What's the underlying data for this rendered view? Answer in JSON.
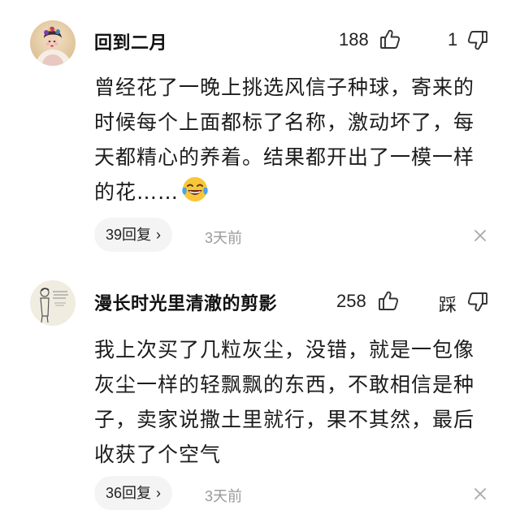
{
  "comments": [
    {
      "username": "回到二月",
      "likes": "188",
      "dislike": "1",
      "body": "曾经花了一晚上挑选风信子种球，寄来的时候每个上面都标了名称，激动坏了，每天都精心的养着。结果都开出了一模一样的花……",
      "emoji": "laughing-tears-emoji",
      "replies": "39回复",
      "reply_chevron": "›",
      "time": "3天前"
    },
    {
      "username": "漫长时光里清澈的剪影",
      "likes": "258",
      "dislike": "踩",
      "body": "我上次买了几粒灰尘，没错，就是一包像灰尘一样的轻飘飘的东西，不敢相信是种子，卖家说撒土里就行，果不其然，最后收获了个空气",
      "replies": "36回复",
      "reply_chevron": "›",
      "time": "3天前"
    }
  ],
  "colors": {
    "text": "#1a1a1a",
    "muted": "#9a9a9a",
    "reply_bg": "#f4f4f4",
    "icon": "#333333"
  }
}
